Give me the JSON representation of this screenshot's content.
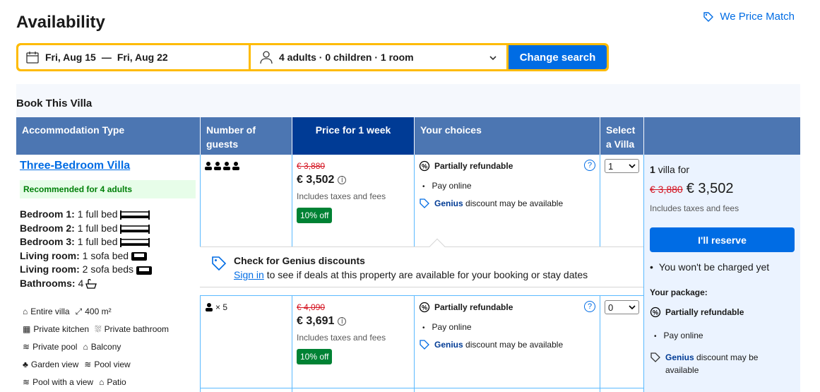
{
  "header": {
    "title": "Availability",
    "price_match": "We Price Match"
  },
  "search": {
    "date_from": "Fri, Aug 15",
    "date_sep": "—",
    "date_to": "Fri, Aug 22",
    "guests": "4 adults · 0 children · 1 room",
    "button": "Change search"
  },
  "section_title": "Book This Villa",
  "columns": {
    "type": "Accommodation Type",
    "guests": "Number of guests",
    "price": "Price for 1 week",
    "choices": "Your choices",
    "select": "Select a Villa"
  },
  "villa": {
    "name": "Three-Bedroom Villa",
    "recommendation": "Recommended for 4 adults",
    "beds": [
      {
        "room": "Bedroom 1:",
        "desc": "1 full bed"
      },
      {
        "room": "Bedroom 2:",
        "desc": "1 full bed"
      },
      {
        "room": "Bedroom 3:",
        "desc": "1 full bed"
      },
      {
        "room": "Living room:",
        "desc": "1 sofa bed"
      },
      {
        "room": "Living room:",
        "desc": "2 sofa beds"
      },
      {
        "room": "Bathrooms:",
        "desc": "4"
      }
    ],
    "facilities": [
      "Entire villa",
      "400 m²",
      "Private kitchen",
      "Private bathroom",
      "Private pool",
      "Balcony",
      "Garden view",
      "Pool view",
      "Pool with a view",
      "Patio"
    ]
  },
  "options": [
    {
      "guests_label": "",
      "old_price": "€ 3,880",
      "price": "€ 3,502",
      "taxes": "Includes taxes and fees",
      "discount": "10% off",
      "refund": "Partially refundable",
      "payment": "Pay online",
      "genius": "Genius",
      "genius_text": "discount may be available",
      "selected": "1"
    },
    {
      "guests_label": "× 5",
      "old_price": "€ 4,090",
      "price": "€ 3,691",
      "taxes": "Includes taxes and fees",
      "discount": "10% off",
      "refund": "Partially refundable",
      "payment": "Pay online",
      "genius": "Genius",
      "genius_text": "discount may be available",
      "selected": "0"
    }
  ],
  "genius_banner": {
    "title": "Check for Genius discounts",
    "link": "Sign in",
    "text": " to see if deals at this property are available for your booking or stay dates"
  },
  "summary": {
    "count": "1",
    "for_text": "villa for",
    "old_price": "€ 3,880",
    "price": "€ 3,502",
    "taxes": "Includes taxes and fees",
    "reserve": "I'll reserve",
    "no_charge": "You won't be charged yet",
    "package_label": "Your package:",
    "refund": "Partially refundable",
    "payment": "Pay online",
    "genius": "Genius",
    "genius_text": "discount may be available"
  },
  "colors": {
    "accent": "#006ce4",
    "header_col": "#4c76b2",
    "active_col": "#003b95",
    "discount": "#008234",
    "strike": "#d4111e",
    "search_border": "#febb02"
  }
}
